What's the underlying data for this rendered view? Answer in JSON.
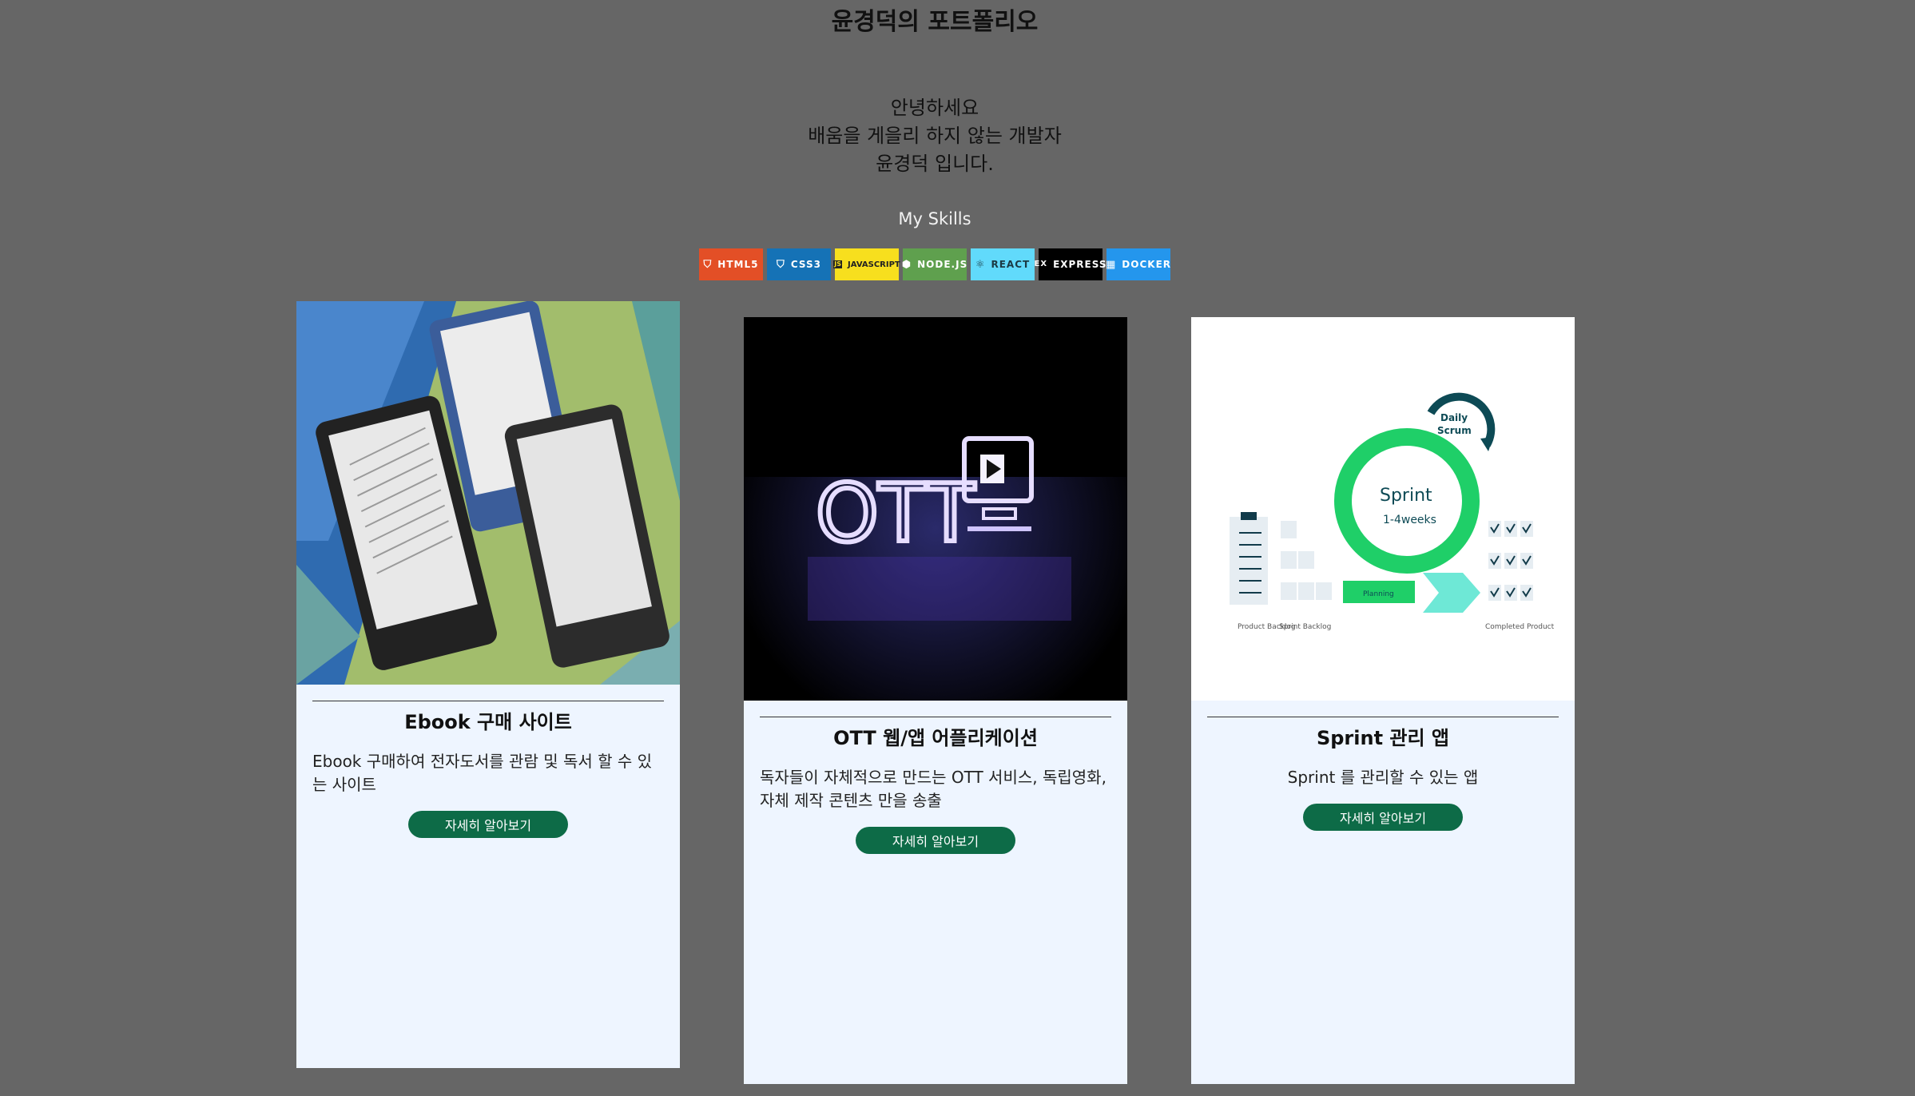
{
  "header": {
    "title": "윤경덕의 포트폴리오"
  },
  "intro": {
    "lines": [
      "안녕하세요",
      "배움을 게을리 하지 않는 개발자",
      "윤경덕 입니다."
    ]
  },
  "skills": {
    "title": "My Skills",
    "badges": [
      {
        "label": "HTML5",
        "icon": "html5-icon",
        "glyph": "5",
        "color": "#e34f26"
      },
      {
        "label": "CSS3",
        "icon": "css3-icon",
        "glyph": "3",
        "color": "#1572b6"
      },
      {
        "label": "JAVASCRIPT",
        "icon": "javascript-icon",
        "glyph": "JS",
        "color": "#f7df1e"
      },
      {
        "label": "NODE.JS",
        "icon": "nodejs-icon",
        "glyph": "⬢",
        "color": "#5fa04e"
      },
      {
        "label": "REACT",
        "icon": "react-icon",
        "glyph": "⚛",
        "color": "#61dafb"
      },
      {
        "label": "EXPRESS",
        "icon": "express-icon",
        "glyph": "ex",
        "color": "#000000"
      },
      {
        "label": "DOCKER",
        "icon": "docker-icon",
        "glyph": "🐳",
        "color": "#2496ed"
      }
    ]
  },
  "projects": [
    {
      "title": "Ebook 구매 사이트",
      "description": "Ebook 구매하여 전자도서를 관람 및 독서 할 수 있는 사이트",
      "button": "자세히 알아보기",
      "image": "ebook-readers-image"
    },
    {
      "title": "OTT 웹/앱 어플리케이션",
      "description": "독자들이 자체적으로 만드는 OTT 서비스, 독립영화, 자체 제작 콘텐츠 만을 송출",
      "button": "자세히 알아보기",
      "image": "ott-neon-image",
      "image_text": "OTT"
    },
    {
      "title": "Sprint 관리 앱",
      "description": "Sprint 를 관리할 수 있는 앱",
      "button": "자세히 알아보기",
      "image": "sprint-diagram-image",
      "diagram": {
        "sprint": "Sprint",
        "duration": "1-4weeks",
        "daily": "Daily",
        "scrum": "Scrum",
        "planning": "Planning",
        "product_backlog": "Product Backlog",
        "sprint_backlog": "Sprint Backlog",
        "completed": "Completed Product"
      }
    }
  ]
}
